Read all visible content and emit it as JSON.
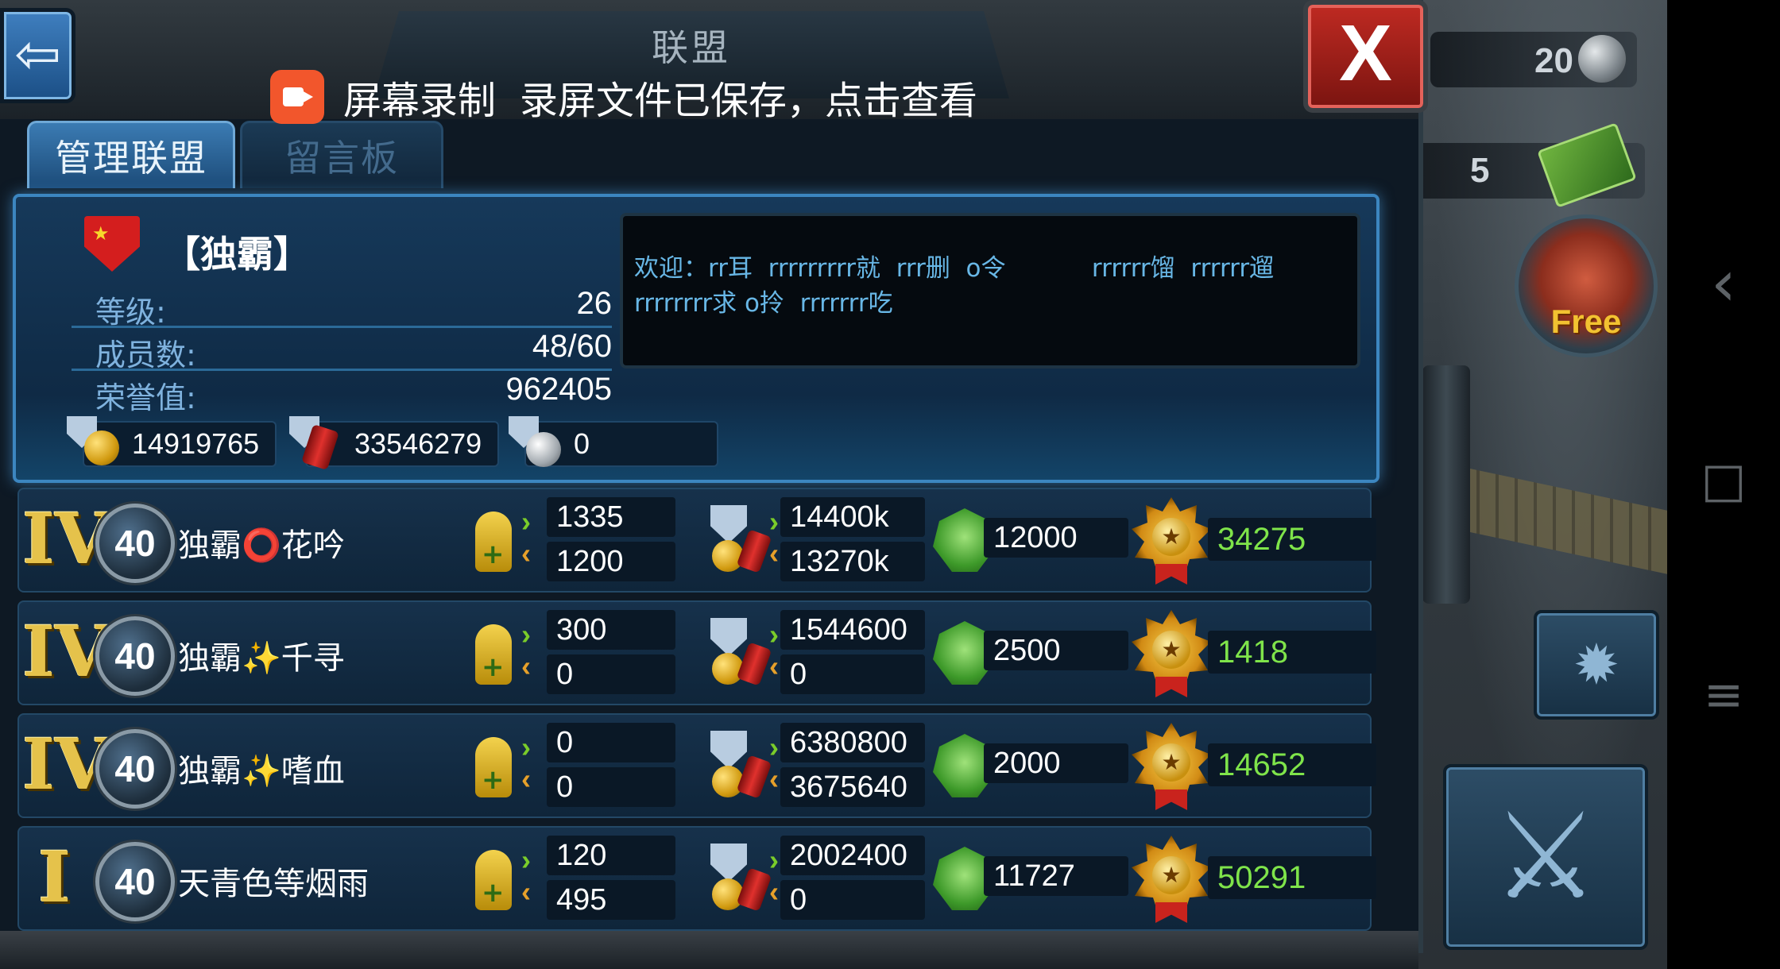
{
  "system_nav": {
    "back": "‹",
    "home": "□",
    "menu": "≡"
  },
  "screen_recording": {
    "title": "屏幕录制",
    "message": "录屏文件已保存，点击查看"
  },
  "window": {
    "title": "联盟",
    "close_label": "X",
    "back_label": "⇦"
  },
  "tabs": [
    {
      "label": "管理联盟",
      "active": true
    },
    {
      "label": "留言板",
      "active": false
    }
  ],
  "alliance": {
    "name": "【独霸】",
    "stats": [
      {
        "label": "等级:",
        "value": "26"
      },
      {
        "label": "成员数:",
        "value": "48/60"
      },
      {
        "label": "荣誉值:",
        "value": "962405"
      }
    ],
    "resources": [
      {
        "type": "gold",
        "icon": "shield-gold-icon",
        "value": "14919765"
      },
      {
        "type": "oil",
        "icon": "shield-oil-icon",
        "value": "33546279"
      },
      {
        "type": "steel",
        "icon": "shield-steel-icon",
        "value": "0"
      }
    ],
    "welcome_message": "欢迎：rr耳  rrrrrrrrr就  rrr删  o令           rrrrrr馏  rrrrrr遛\nrrrrrrrr求 o拎  rrrrrrr吃"
  },
  "members": [
    {
      "rank": "IV",
      "level": "40",
      "name": "独霸⭕花吟",
      "troops_in": "1335",
      "troops_out": "1200",
      "res_in": "14400k",
      "res_out": "13270k",
      "power": "12000",
      "honor": "34275"
    },
    {
      "rank": "IV",
      "level": "40",
      "name": "独霸✨千寻",
      "troops_in": "300",
      "troops_out": "0",
      "res_in": "1544600",
      "res_out": "0",
      "power": "2500",
      "honor": "1418"
    },
    {
      "rank": "IV",
      "level": "40",
      "name": "独霸✨嗜血",
      "troops_in": "0",
      "troops_out": "0",
      "res_in": "6380800",
      "res_out": "3675640",
      "power": "2000",
      "honor": "14652"
    },
    {
      "rank": "I",
      "level": "40",
      "name": "天青色等烟雨",
      "troops_in": "120",
      "troops_out": "495",
      "res_in": "2002400",
      "res_out": "0",
      "power": "11727",
      "honor": "50291"
    }
  ],
  "side_hud": {
    "top_counter": "20",
    "cash_counter": "5",
    "free_label": "Free"
  },
  "colors": {
    "accent_blue": "#3c86c0",
    "honor_green": "#7fe44a",
    "close_red": "#bf2a22",
    "record_orange": "#f2562c"
  }
}
